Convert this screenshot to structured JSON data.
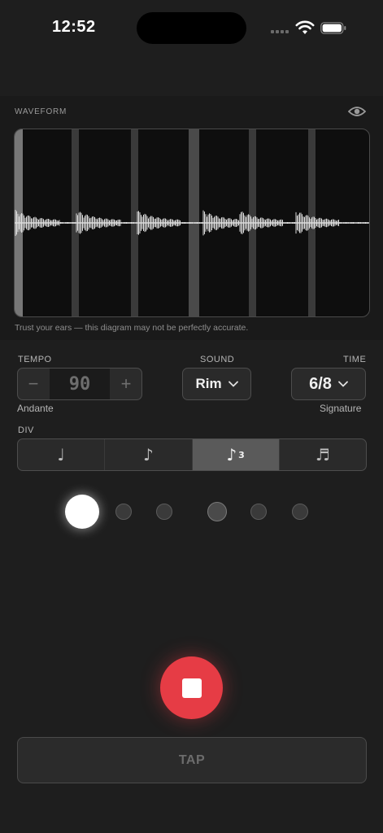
{
  "status_bar": {
    "time": "12:52",
    "icons": [
      "cellular-signal-icon",
      "wifi-icon",
      "battery-icon"
    ]
  },
  "waveform": {
    "label": "WAVEFORM",
    "visibility_icon": "eye-icon",
    "disclaimer": "Trust your ears — this diagram may not be perfectly accurate."
  },
  "tempo": {
    "label": "TEMPO",
    "value": "90",
    "minus": "−",
    "plus": "+",
    "marking": "Andante"
  },
  "sound": {
    "label": "SOUND",
    "selected": "Rim"
  },
  "time_signature": {
    "label": "TIME",
    "selected": "6/8",
    "caption": "Signature"
  },
  "division": {
    "label": "DIV",
    "options": [
      {
        "symbol": "♩",
        "sup": ""
      },
      {
        "symbol": "♪",
        "sup": ""
      },
      {
        "symbol": "♪",
        "sup": "3"
      },
      {
        "symbol": "♬",
        "sup": ""
      }
    ],
    "selected_index": 2
  },
  "beats": {
    "count": 6,
    "current": 1,
    "accented": [
      4
    ]
  },
  "transport": {
    "state": "playing",
    "stop_icon": "stop-icon"
  },
  "tap": {
    "label": "TAP"
  },
  "colors": {
    "background": "#1e1e1e",
    "stop": "#e63c45",
    "active_beat": "#ffffff",
    "segment_active": "#5a5a5a"
  }
}
